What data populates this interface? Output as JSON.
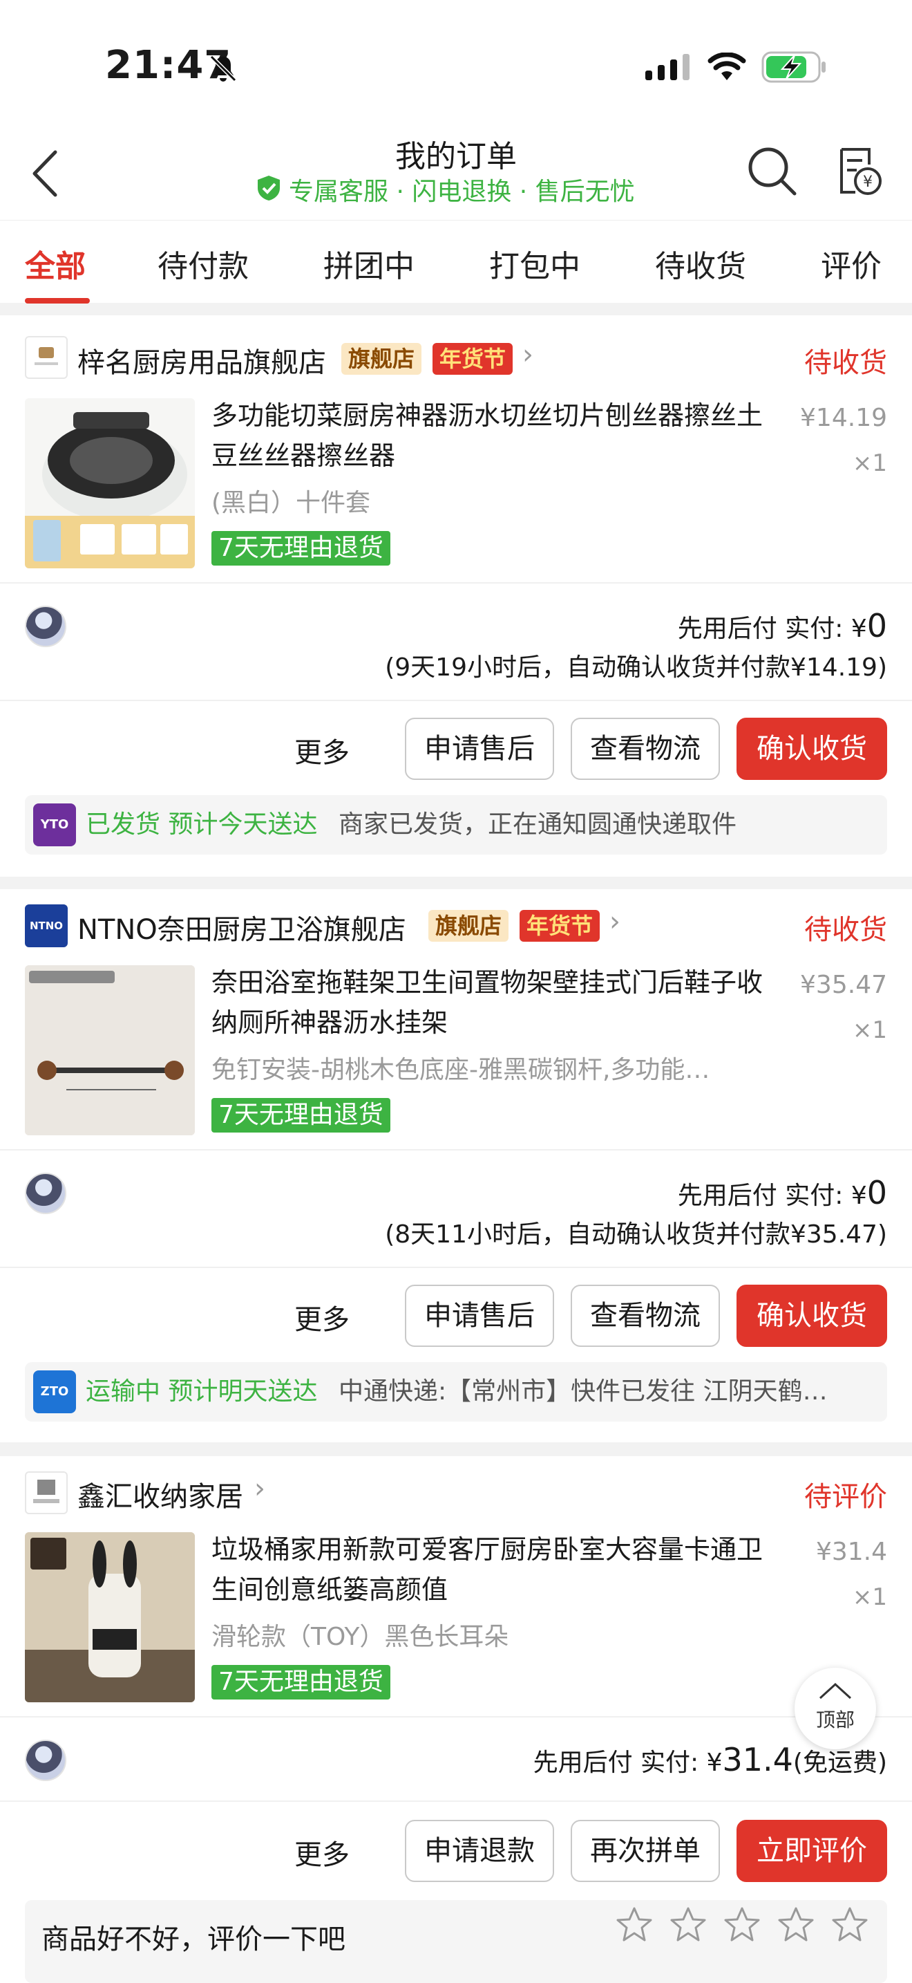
{
  "status_bar": {
    "time": "21:47"
  },
  "nav": {
    "title": "我的订单",
    "subtitle": "专属客服 · 闪电退换 · 售后无忧"
  },
  "tabs": [
    "全部",
    "待付款",
    "拼团中",
    "打包中",
    "待收货",
    "评价"
  ],
  "orders": [
    {
      "shop": "梓名厨房用品旗舰店",
      "badge1": "旗舰店",
      "badge2": "年货节",
      "status": "待收货",
      "title": "多功能切菜厨房神器沥水切丝切片刨丝器擦丝土豆丝丝器擦丝器",
      "spec": "(黑白）十件套",
      "return_tag": "7天无理由退货",
      "price": "¥14.19",
      "qty": "×1",
      "pay_label": "先用后付 实付: ¥",
      "pay_amount": "0",
      "note": "(9天19小时后，自动确认收货并付款¥14.19)",
      "more": "更多",
      "btn1": "申请售后",
      "btn2": "查看物流",
      "btn3": "确认收货",
      "track_icon": "YTO",
      "track_status": "已发货 预计今天送达",
      "track_detail": "商家已发货，正在通知圆通快递取件"
    },
    {
      "shop": "NTNO奈田厨房卫浴旗舰店",
      "shop_logo": "NTNO",
      "badge1": "旗舰店",
      "badge2": "年货节",
      "status": "待收货",
      "title": "奈田浴室拖鞋架卫生间置物架壁挂式门后鞋子收纳厕所神器沥水挂架",
      "spec": "免钉安装-胡桃木色底座-雅黑碳钢杆,多功能…",
      "return_tag": "7天无理由退货",
      "price": "¥35.47",
      "qty": "×1",
      "pay_label": "先用后付 实付: ¥",
      "pay_amount": "0",
      "note": "(8天11小时后，自动确认收货并付款¥35.47)",
      "more": "更多",
      "btn1": "申请售后",
      "btn2": "查看物流",
      "btn3": "确认收货",
      "track_icon": "ZTO",
      "track_status": "运输中 预计明天送达",
      "track_detail": "中通快递:【常州市】快件已发往 江阴天鹤…"
    },
    {
      "shop": "鑫汇收纳家居",
      "status": "待评价",
      "title": "垃圾桶家用新款可爱客厅厨房卧室大容量卡通卫生间创意纸篓高颜值",
      "spec": "滑轮款（TOY）黑色长耳朵",
      "return_tag": "7天无理由退货",
      "price": "¥31.4",
      "qty": "×1",
      "pay_label": "先用后付 实付: ¥",
      "pay_amount": "31.4",
      "pay_suffix": "(免运费)",
      "more": "更多",
      "btn1": "申请退款",
      "btn2": "再次拼单",
      "btn3": "立即评价",
      "review_prompt": "商品好不好，评价一下吧"
    }
  ],
  "top_button": "顶部"
}
